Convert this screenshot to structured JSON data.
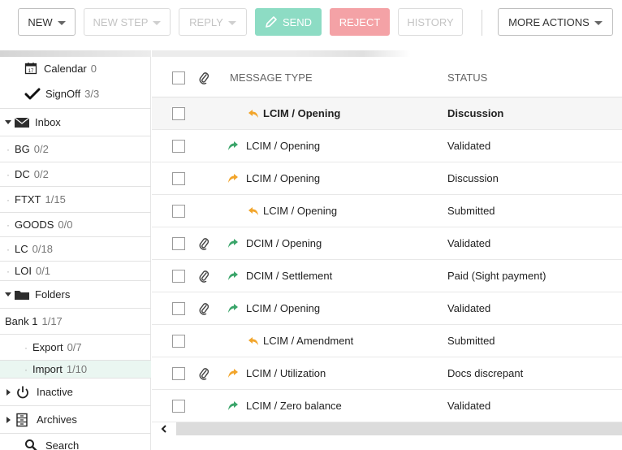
{
  "toolbar": {
    "new_label": "NEW",
    "new_step_label": "NEW STEP",
    "reply_label": "REPLY",
    "send_label": "SEND",
    "reject_label": "REJECT",
    "history_label": "HISTORY",
    "more_actions_label": "MORE ACTIONS"
  },
  "sidebar": {
    "calendar": {
      "label": "Calendar",
      "count": "0",
      "icon": "calendar-icon"
    },
    "signoff": {
      "label": "SignOff",
      "count": "3/3",
      "icon": "checkmark-icon"
    },
    "inbox": {
      "label": "Inbox",
      "icon": "envelope-icon"
    },
    "inbox_items": [
      {
        "label": "BG",
        "count": "0/2"
      },
      {
        "label": "DC",
        "count": "0/2"
      },
      {
        "label": "FTXT",
        "count": "1/15"
      },
      {
        "label": "GOODS",
        "count": "0/0"
      },
      {
        "label": "LC",
        "count": "0/18"
      },
      {
        "label": "LOI",
        "count": "0/1"
      }
    ],
    "folders": {
      "label": "Folders",
      "icon": "folder-icon"
    },
    "bank": {
      "label": "Bank 1",
      "count": "1/17"
    },
    "bank_items": [
      {
        "label": "Export",
        "count": "0/7"
      },
      {
        "label": "Import",
        "count": "1/10"
      }
    ],
    "inactive": {
      "label": "Inactive",
      "icon": "power-icon"
    },
    "archives": {
      "label": "Archives",
      "icon": "archive-icon"
    },
    "search": {
      "label": "Search",
      "icon": "search-icon"
    }
  },
  "table": {
    "columns": {
      "message_type": "MESSAGE TYPE",
      "status": "STATUS"
    },
    "rows": [
      {
        "message_type": "LCIM / Opening",
        "status": "Discussion",
        "attachment": false,
        "direction": "reply",
        "indent": true,
        "bold": true
      },
      {
        "message_type": "LCIM / Opening",
        "status": "Validated",
        "attachment": false,
        "direction": "outgoing-green",
        "indent": false,
        "bold": false
      },
      {
        "message_type": "LCIM / Opening",
        "status": "Discussion",
        "attachment": false,
        "direction": "outgoing-orange",
        "indent": false,
        "bold": false
      },
      {
        "message_type": "LCIM / Opening",
        "status": "Submitted",
        "attachment": false,
        "direction": "reply",
        "indent": true,
        "bold": false
      },
      {
        "message_type": "DCIM / Opening",
        "status": "Validated",
        "attachment": true,
        "direction": "outgoing-green",
        "indent": false,
        "bold": false
      },
      {
        "message_type": "DCIM / Settlement",
        "status": "Paid (Sight payment)",
        "attachment": true,
        "direction": "outgoing-green",
        "indent": false,
        "bold": false
      },
      {
        "message_type": "LCIM / Opening",
        "status": "Validated",
        "attachment": true,
        "direction": "outgoing-green",
        "indent": false,
        "bold": false
      },
      {
        "message_type": "LCIM / Amendment",
        "status": "Submitted",
        "attachment": false,
        "direction": "reply",
        "indent": true,
        "bold": false
      },
      {
        "message_type": "LCIM / Utilization",
        "status": "Docs discrepant",
        "attachment": true,
        "direction": "outgoing-orange",
        "indent": false,
        "bold": false
      },
      {
        "message_type": "LCIM / Zero balance",
        "status": "Validated",
        "attachment": false,
        "direction": "outgoing-green",
        "indent": false,
        "bold": false
      }
    ]
  },
  "colors": {
    "send_bg": "#8ddcc4",
    "reject_bg": "#f4a2a6",
    "arrow_green": "#3aa56a",
    "arrow_orange": "#f2a52b",
    "active_row": "#eaf6f1"
  }
}
